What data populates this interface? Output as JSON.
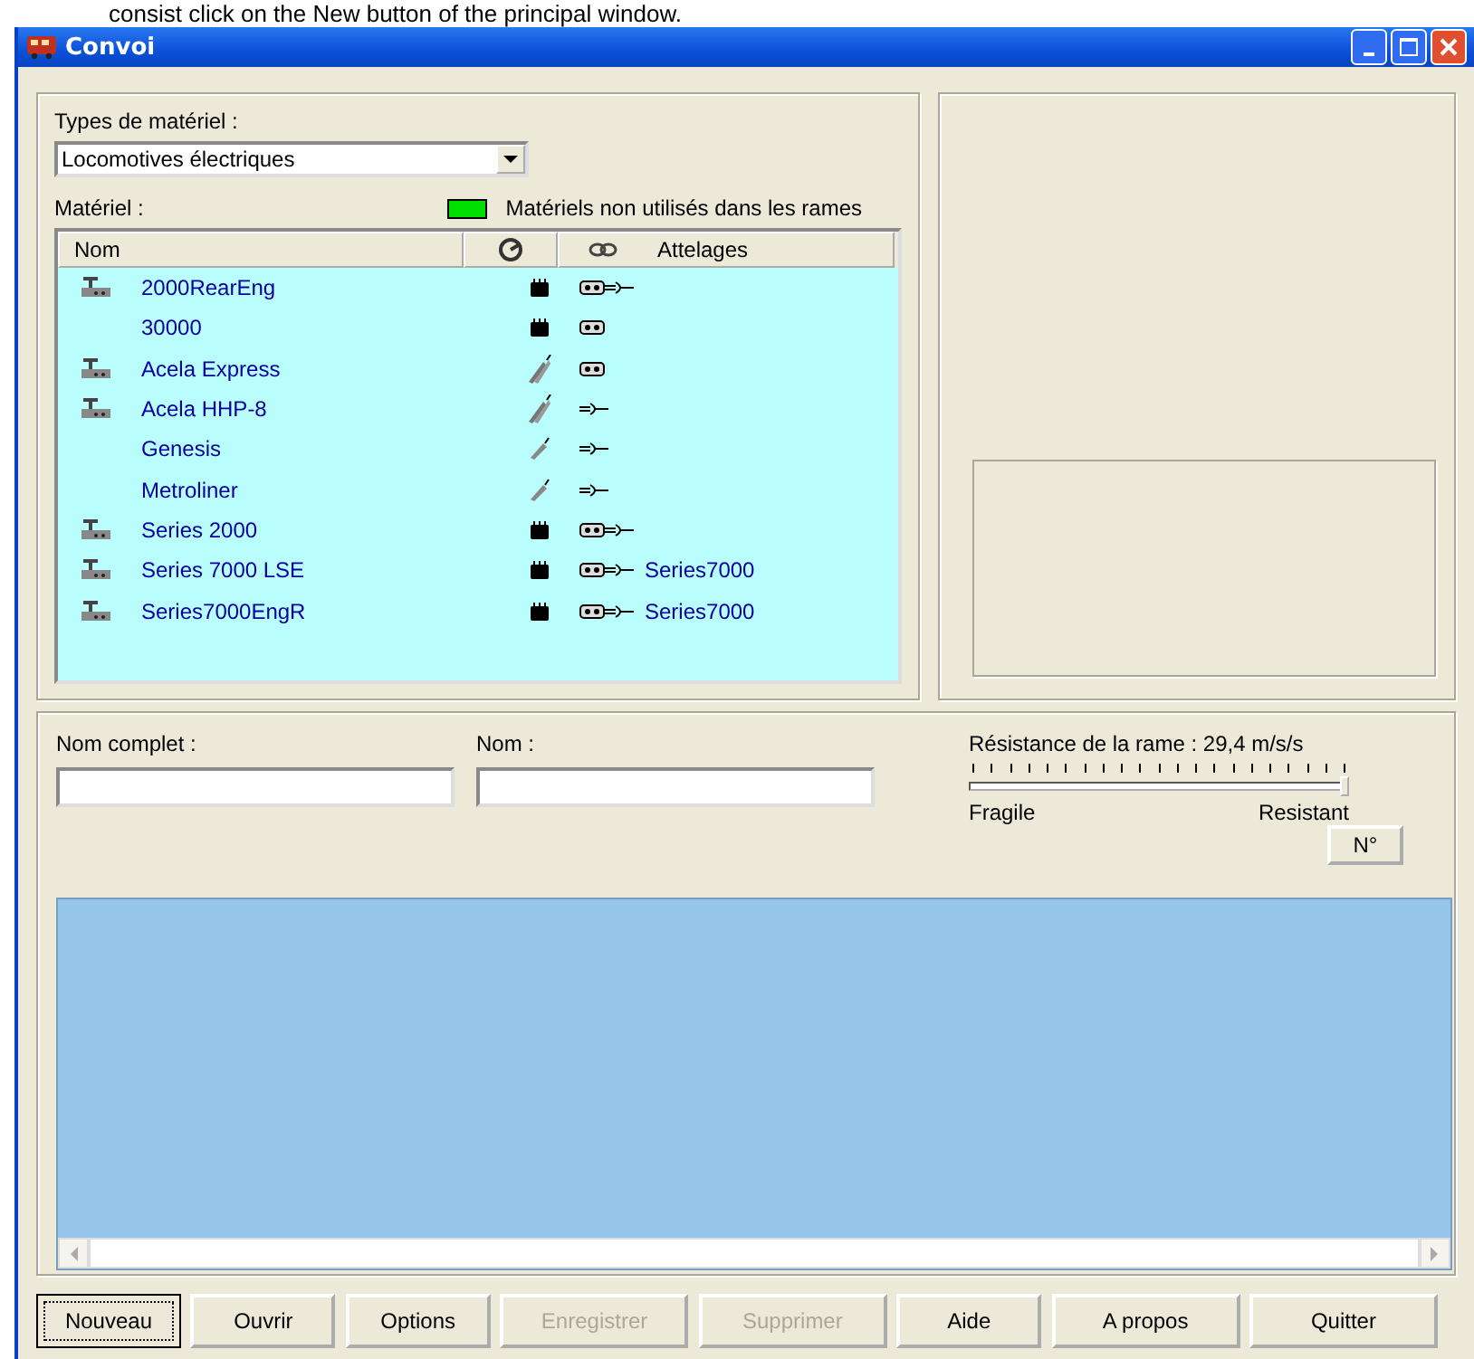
{
  "caption": "consist click on the New button of the principal window.",
  "window": {
    "title": "Convoi"
  },
  "types": {
    "label": "Types de matériel :",
    "value": "Locomotives électriques"
  },
  "materiel": {
    "label": "Matériel :",
    "legend": {
      "text": "Matériels non utilisés dans les rames",
      "color": "#00e000"
    }
  },
  "table": {
    "columns": [
      "Nom",
      "Attelages"
    ],
    "rows": [
      {
        "kind": "block",
        "motor": true,
        "box_coupler": true,
        "hook_coupler": true,
        "name": "2000RearEng"
      },
      {
        "kind": "block",
        "motor": false,
        "box_coupler": true,
        "hook_coupler": false,
        "name": "30000"
      },
      {
        "kind": "multi",
        "motor": true,
        "box_coupler": true,
        "hook_coupler": false,
        "name": "Acela Express"
      },
      {
        "kind": "multi",
        "motor": true,
        "box_coupler": false,
        "hook_coupler": true,
        "name": "Acela HHP-8"
      },
      {
        "kind": "single",
        "motor": false,
        "box_coupler": false,
        "hook_coupler": true,
        "name": "Genesis"
      },
      {
        "kind": "single",
        "motor": false,
        "box_coupler": false,
        "hook_coupler": true,
        "name": "Metroliner"
      },
      {
        "kind": "block",
        "motor": true,
        "box_coupler": true,
        "hook_coupler": true,
        "name": "Series 2000"
      },
      {
        "kind": "block",
        "motor": true,
        "box_coupler": true,
        "hook_coupler": true,
        "name": "Series 7000 LSE",
        "attelage": "Series7000"
      },
      {
        "kind": "block",
        "motor": true,
        "box_coupler": true,
        "hook_coupler": true,
        "name": "Series7000EngR",
        "attelage": "Series7000"
      }
    ]
  },
  "nom_complet": {
    "label": "Nom complet :"
  },
  "nom": {
    "label": "Nom :"
  },
  "resistance": {
    "label": "Résistance de la rame : 29,4 m/s/s",
    "level": 1.0,
    "min_label": "Fragile",
    "max_label": "Resistant"
  },
  "number_button": "N°",
  "buttons": [
    {
      "label": "Nouveau",
      "disabled": false,
      "focused": true
    },
    {
      "label": "Ouvrir",
      "disabled": false,
      "focused": false
    },
    {
      "label": "Options",
      "disabled": false,
      "focused": false
    },
    {
      "label": "Enregistrer",
      "disabled": true,
      "focused": false
    },
    {
      "label": "Supprimer",
      "disabled": true,
      "focused": false
    },
    {
      "label": "Aide",
      "disabled": false,
      "focused": false
    },
    {
      "label": "A propos",
      "disabled": false,
      "focused": false
    },
    {
      "label": "Quitter",
      "disabled": false,
      "focused": false
    }
  ]
}
